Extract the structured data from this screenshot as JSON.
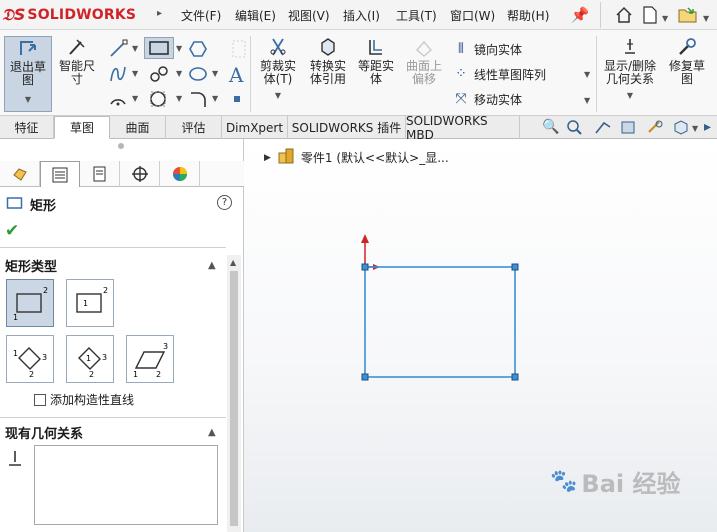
{
  "app": {
    "logo_text": "SOLIDWORKS",
    "menu": [
      "文件(F)",
      "编辑(E)",
      "视图(V)",
      "插入(I)",
      "工具(T)",
      "窗口(W)",
      "帮助(H)"
    ]
  },
  "ribbon": {
    "exit_sketch": "退出草图",
    "smart_dim": "智能尺寸",
    "trim": "剪裁实体(T)",
    "convert": "转换实体引用",
    "offset": "等距实体",
    "surface_offset": "曲面上偏移",
    "mirror": "镜向实体",
    "linear_pattern": "线性草图阵列",
    "move": "移动实体",
    "show_delete": "显示/删除几何关系",
    "repair": "修复草图"
  },
  "tabs": [
    "特征",
    "草图",
    "曲面",
    "评估",
    "DimXpert",
    "SOLIDWORKS 插件",
    "SOLIDWORKS MBD"
  ],
  "active_tab": "草图",
  "panel": {
    "title": "矩形",
    "section_rect_type": "矩形类型",
    "construction_label": "添加构造性直线",
    "section_relations": "现有几何关系"
  },
  "tree": {
    "item": "零件1 (默认<<默认>_显..."
  },
  "watermark": "Bai 经验",
  "colors": {
    "accent": "#3d8fd6",
    "logo": "#d12228",
    "ok": "#2e9b3a"
  }
}
